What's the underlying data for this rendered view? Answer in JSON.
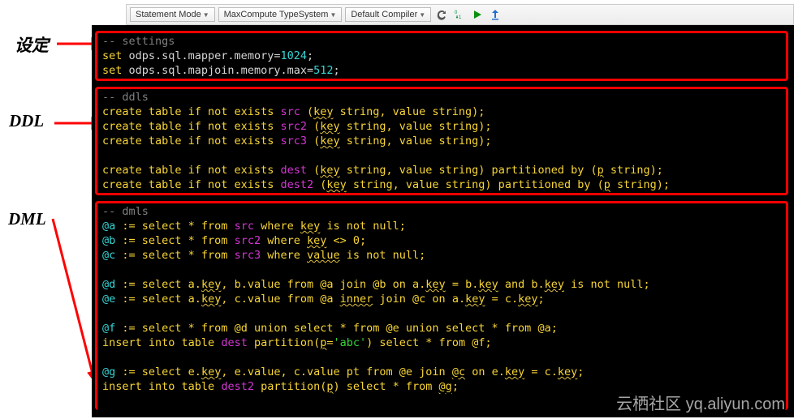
{
  "toolbar": {
    "mode": "Statement Mode",
    "typesystem": "MaxCompute TypeSystem",
    "compiler": "Default Compiler"
  },
  "labels": {
    "settings": "设定",
    "ddl": "DDL",
    "dml": "DML"
  },
  "code": {
    "settings": {
      "comment": "-- settings",
      "l1": {
        "p": "set ",
        "k": "odps.sql.mapper.memory",
        "eq": "=",
        "v": "1024",
        "end": ";"
      },
      "l2": {
        "p": "set ",
        "k": "odps.sql.mapjoin.memory.max",
        "eq": "=",
        "v": "512",
        "end": ";"
      }
    },
    "ddls": {
      "comment": "-- ddls",
      "l1": {
        "p": "create table if not exists ",
        "tbl": "src",
        "cols": " (",
        "k1": "key",
        "c1": " string, value string);"
      },
      "l2": {
        "p": "create table if not exists ",
        "tbl": "src2",
        "cols": " (",
        "k1": "key",
        "c1": " string, value string);"
      },
      "l3": {
        "p": "create table if not exists ",
        "tbl": "src3",
        "cols": " (",
        "k1": "key",
        "c1": " string, value string);"
      },
      "l4": {
        "p": "create table if not exists ",
        "tbl": "dest",
        "cols": " (",
        "k1": "key",
        "c1": " string, value string) partitioned by (",
        "pk": "p",
        "c2": " string);"
      },
      "l5": {
        "p": "create table if not exists ",
        "tbl": "dest2",
        "cols": " (",
        "k1": "key",
        "c1": " string, value string) partitioned by (",
        "pk": "p",
        "c2": " string);"
      }
    },
    "dmls": {
      "comment": "-- dmls",
      "a": {
        "v": "@a",
        "s": " := select * from ",
        "t": "src",
        "w": " where ",
        "k": "key",
        "r": " is not null;"
      },
      "b": {
        "v": "@b",
        "s": " := select * from ",
        "t": "src2",
        "w": " where ",
        "k": "key",
        "r": " <> 0;"
      },
      "c": {
        "v": "@c",
        "s": " := select * from ",
        "t": "src3",
        "w": " where ",
        "k": "value",
        "r": " is not null;"
      },
      "d": {
        "v": "@d",
        "s": " := select a.",
        "k1": "key",
        "m": ", b.value from @a join @b on a.",
        "k2": "key",
        "m2": " = b.",
        "k3": "key",
        "m3": " and b.",
        "k4": "key",
        "r": " is not null;"
      },
      "e": {
        "v": "@e",
        "s": " := select a.",
        "k1": "key",
        "m": ", c.value from @a ",
        "in": "inner",
        "m2": " join @c on a.",
        "k2": "key",
        "m3": " = c.",
        "k3": "key",
        "r": ";"
      },
      "f": {
        "v": "@f",
        "s": " := select * from @d union select * from @e union select * from @a;"
      },
      "ins": {
        "p": "insert into table ",
        "t": "dest",
        "m": " partition(",
        "pk": "p",
        "eq": "=",
        "s": "'abc'",
        "r": ") select * from @f;"
      },
      "g": {
        "v": "@g",
        "s": " := select e.",
        "k1": "key",
        "m": ", e.value, c.value pt from @e join ",
        "jc": "@c",
        "m2": " on e.",
        "k2": "key",
        "m3": " = c.",
        "k3": "key",
        "r": ";"
      },
      "ins2": {
        "p": "insert into table ",
        "t": "dest2",
        "m": " partition(",
        "pk": "p",
        "r": ") select * from ",
        "gg": "@g",
        "end": ";"
      }
    }
  },
  "watermark": "云栖社区 yq.aliyun.com"
}
